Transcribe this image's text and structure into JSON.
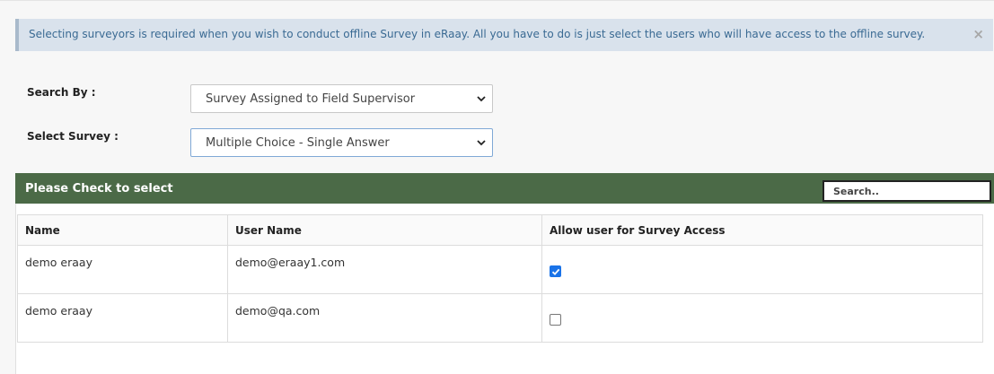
{
  "alert": {
    "message": "Selecting surveyors is required when you wish to conduct offline Survey in eRaay. All you have to do is just select the users who will have access to the offline survey.",
    "close_label": "×"
  },
  "form": {
    "search_by_label": "Search By :",
    "search_by_value": "Survey Assigned to Field Supervisor",
    "select_survey_label": "Select Survey :",
    "select_survey_value": "Multiple Choice - Single Answer"
  },
  "panel": {
    "title": "Please Check to select",
    "search_placeholder": "Search.."
  },
  "table": {
    "headers": [
      "Name",
      "User Name",
      "Allow user for Survey Access"
    ],
    "rows": [
      {
        "name": "demo eraay",
        "username": "demo@eraay1.com",
        "allowed": true
      },
      {
        "name": "demo eraay",
        "username": "demo@qa.com",
        "allowed": false
      }
    ]
  },
  "colors": {
    "alert_bg": "#d9e2ec",
    "alert_text": "#3a6a93",
    "panel_header_bg": "#4b6a47",
    "checkbox_checked": "#1a73e8"
  }
}
